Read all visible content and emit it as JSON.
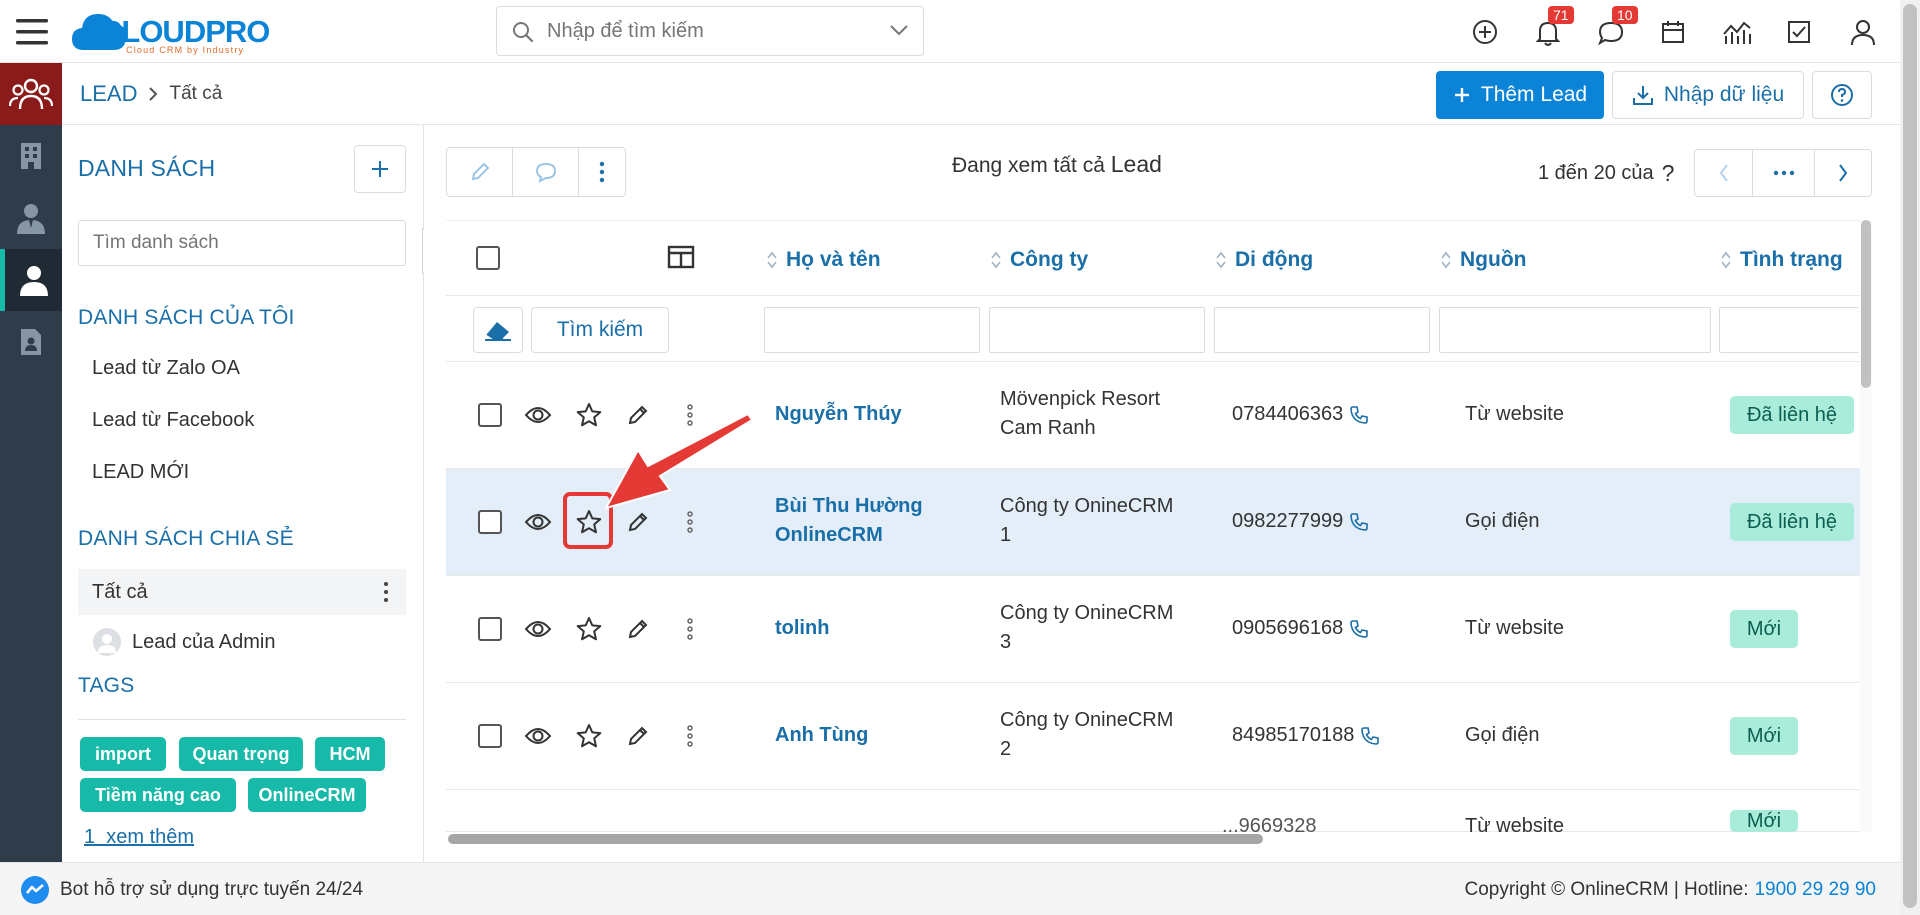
{
  "app": {
    "logo_text": "CLOUDPRO",
    "logo_sub": "Cloud CRM by Industry"
  },
  "topbar": {
    "search_placeholder": "Nhập để tìm kiếm",
    "notification_count": "71",
    "chat_count": "10"
  },
  "breadcrumb": {
    "module": "LEAD",
    "current": "Tất cả"
  },
  "actions": {
    "add_lead": "Thêm Lead",
    "import": "Nhập dữ liệu"
  },
  "sidebar": {
    "title": "DANH SÁCH",
    "search_placeholder": "Tìm danh sách",
    "my_lists_title": "DANH SÁCH CỦA TÔI",
    "my_lists": [
      "Lead từ Zalo OA",
      "Lead từ Facebook",
      "LEAD MỚI"
    ],
    "shared_title": "DANH SÁCH CHIA SẺ",
    "shared_lists": [
      "Tất cả",
      "Lead của Admin"
    ],
    "tags_title": "TAGS",
    "tags": [
      "import",
      "Quan trọng",
      "HCM",
      "Tiềm năng cao",
      "OnlineCRM"
    ],
    "see_more": "1  xem thêm"
  },
  "main": {
    "viewing_prefix": "Đang xem tất cả",
    "viewing_module": "Lead",
    "pagination_text": "1 đến 20 của",
    "pagination_unknown": "?",
    "search_button": "Tìm kiếm",
    "columns": [
      "Họ và tên",
      "Công ty",
      "Di động",
      "Nguồn",
      "Tình trạng"
    ],
    "rows": [
      {
        "name": "Nguyễn Thúy",
        "company": [
          "Mövenpick Resort",
          "Cam Ranh"
        ],
        "phone": "0784406363",
        "source": "Từ website",
        "status": "Đã liên hệ"
      },
      {
        "name": [
          "Bùi Thu Hường",
          "OnlineCRM"
        ],
        "company": [
          "Công ty OnineCRM",
          "1"
        ],
        "phone": "0982277999",
        "source": "Gọi điện",
        "status": "Đã liên hệ"
      },
      {
        "name": "tolinh",
        "company": [
          "Công ty OnineCRM",
          "3"
        ],
        "phone": "0905696168",
        "source": "Từ website",
        "status": "Mới"
      },
      {
        "name": "Anh Tùng",
        "company": [
          "Công ty OnineCRM",
          "2"
        ],
        "phone": "84985170188",
        "source": "Gọi điện",
        "status": "Mới"
      },
      {
        "name": "",
        "company": [
          ""
        ],
        "phone": "...9669328",
        "source": "Từ website",
        "status": "Mới"
      }
    ]
  },
  "footer": {
    "bot_text": "Bot hỗ trợ sử dụng trực tuyến 24/24",
    "copyright": "Copyright © OnlineCRM | Hotline:",
    "hotline": "1900 29 29 90"
  },
  "colors": {
    "primary": "#0b84d8",
    "link": "#1a6fa8",
    "teal_tag": "#17b9a8",
    "status_bg": "#a8ecd9",
    "highlight_row": "#e3eef9",
    "rail_bg": "#2f3d4b",
    "rail_active": "#8b1a1a",
    "annotation_red": "#e53935"
  }
}
